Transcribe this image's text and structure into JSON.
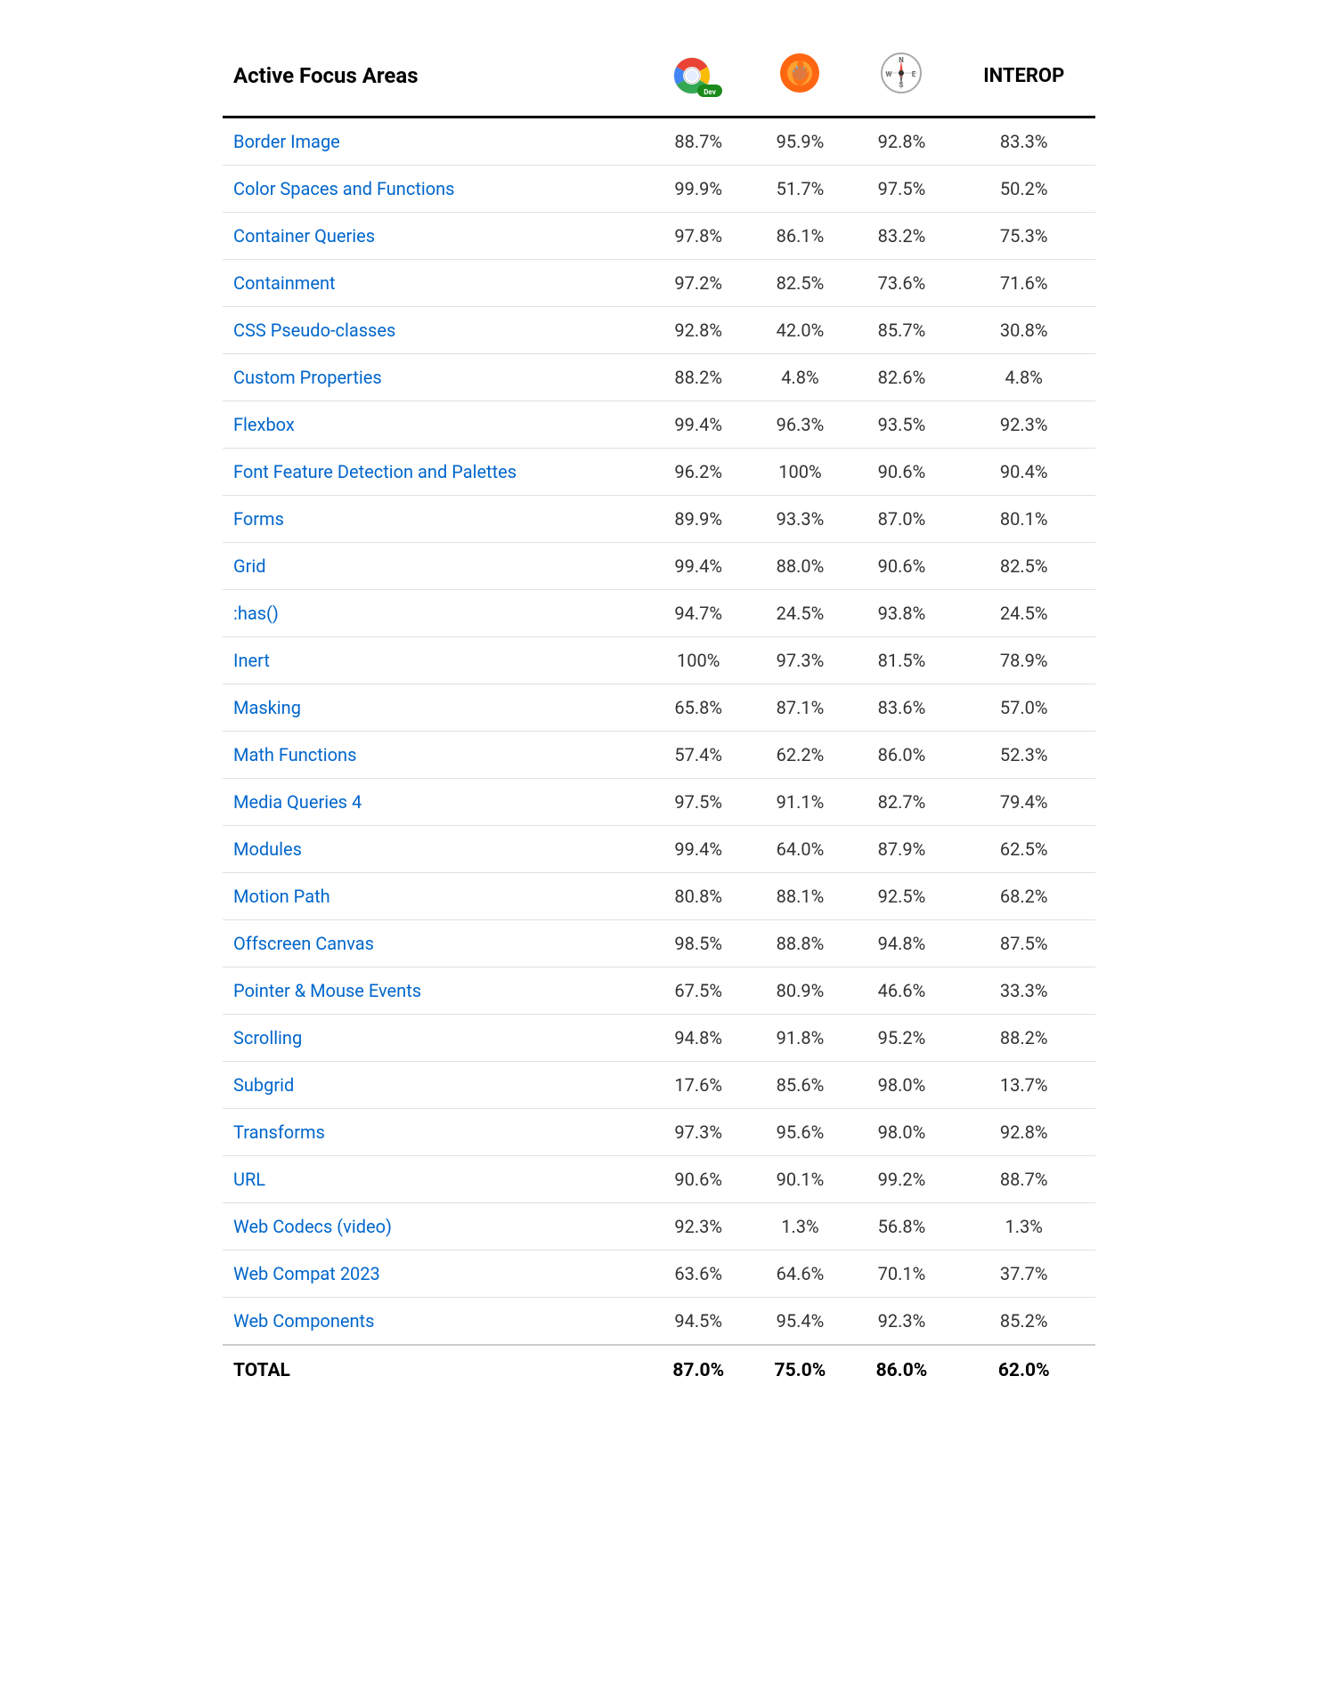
{
  "header": {
    "focus_areas_label": "Active Focus Areas",
    "interop_label": "INTEROP"
  },
  "rows": [
    {
      "name": "Border Image",
      "chrome": "88.7%",
      "firefox": "95.9%",
      "safari": "92.8%",
      "interop": "83.3%"
    },
    {
      "name": "Color Spaces and Functions",
      "chrome": "99.9%",
      "firefox": "51.7%",
      "safari": "97.5%",
      "interop": "50.2%"
    },
    {
      "name": "Container Queries",
      "chrome": "97.8%",
      "firefox": "86.1%",
      "safari": "83.2%",
      "interop": "75.3%"
    },
    {
      "name": "Containment",
      "chrome": "97.2%",
      "firefox": "82.5%",
      "safari": "73.6%",
      "interop": "71.6%"
    },
    {
      "name": "CSS Pseudo-classes",
      "chrome": "92.8%",
      "firefox": "42.0%",
      "safari": "85.7%",
      "interop": "30.8%"
    },
    {
      "name": "Custom Properties",
      "chrome": "88.2%",
      "firefox": "4.8%",
      "safari": "82.6%",
      "interop": "4.8%"
    },
    {
      "name": "Flexbox",
      "chrome": "99.4%",
      "firefox": "96.3%",
      "safari": "93.5%",
      "interop": "92.3%"
    },
    {
      "name": "Font Feature Detection and Palettes",
      "chrome": "96.2%",
      "firefox": "100%",
      "safari": "90.6%",
      "interop": "90.4%"
    },
    {
      "name": "Forms",
      "chrome": "89.9%",
      "firefox": "93.3%",
      "safari": "87.0%",
      "interop": "80.1%"
    },
    {
      "name": "Grid",
      "chrome": "99.4%",
      "firefox": "88.0%",
      "safari": "90.6%",
      "interop": "82.5%"
    },
    {
      "name": ":has()",
      "chrome": "94.7%",
      "firefox": "24.5%",
      "safari": "93.8%",
      "interop": "24.5%"
    },
    {
      "name": "Inert",
      "chrome": "100%",
      "firefox": "97.3%",
      "safari": "81.5%",
      "interop": "78.9%"
    },
    {
      "name": "Masking",
      "chrome": "65.8%",
      "firefox": "87.1%",
      "safari": "83.6%",
      "interop": "57.0%"
    },
    {
      "name": "Math Functions",
      "chrome": "57.4%",
      "firefox": "62.2%",
      "safari": "86.0%",
      "interop": "52.3%"
    },
    {
      "name": "Media Queries 4",
      "chrome": "97.5%",
      "firefox": "91.1%",
      "safari": "82.7%",
      "interop": "79.4%"
    },
    {
      "name": "Modules",
      "chrome": "99.4%",
      "firefox": "64.0%",
      "safari": "87.9%",
      "interop": "62.5%"
    },
    {
      "name": "Motion Path",
      "chrome": "80.8%",
      "firefox": "88.1%",
      "safari": "92.5%",
      "interop": "68.2%"
    },
    {
      "name": "Offscreen Canvas",
      "chrome": "98.5%",
      "firefox": "88.8%",
      "safari": "94.8%",
      "interop": "87.5%"
    },
    {
      "name": "Pointer & Mouse Events",
      "chrome": "67.5%",
      "firefox": "80.9%",
      "safari": "46.6%",
      "interop": "33.3%"
    },
    {
      "name": "Scrolling",
      "chrome": "94.8%",
      "firefox": "91.8%",
      "safari": "95.2%",
      "interop": "88.2%"
    },
    {
      "name": "Subgrid",
      "chrome": "17.6%",
      "firefox": "85.6%",
      "safari": "98.0%",
      "interop": "13.7%"
    },
    {
      "name": "Transforms",
      "chrome": "97.3%",
      "firefox": "95.6%",
      "safari": "98.0%",
      "interop": "92.8%"
    },
    {
      "name": "URL",
      "chrome": "90.6%",
      "firefox": "90.1%",
      "safari": "99.2%",
      "interop": "88.7%"
    },
    {
      "name": "Web Codecs (video)",
      "chrome": "92.3%",
      "firefox": "1.3%",
      "safari": "56.8%",
      "interop": "1.3%"
    },
    {
      "name": "Web Compat 2023",
      "chrome": "63.6%",
      "firefox": "64.6%",
      "safari": "70.1%",
      "interop": "37.7%"
    },
    {
      "name": "Web Components",
      "chrome": "94.5%",
      "firefox": "95.4%",
      "safari": "92.3%",
      "interop": "85.2%"
    }
  ],
  "footer": {
    "total_label": "TOTAL",
    "chrome": "87.0%",
    "firefox": "75.0%",
    "safari": "86.0%",
    "interop": "62.0%"
  }
}
